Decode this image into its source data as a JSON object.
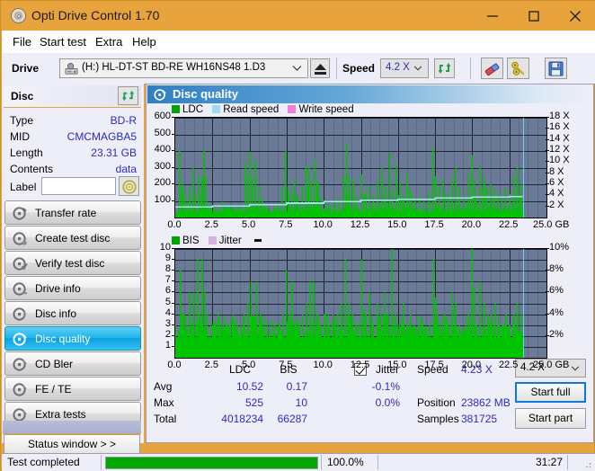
{
  "window": {
    "title": "Opti Drive Control 1.70",
    "icon": "disc-icon",
    "controls": {
      "minimize": "minimize-icon",
      "maximize": "maximize-icon",
      "close": "close-icon"
    },
    "accent_color": "#e8a33d"
  },
  "menu": {
    "items": [
      "File",
      "Start test",
      "Extra",
      "Help"
    ]
  },
  "toolbar": {
    "drive_label": "Drive",
    "drive_value": "(H:)   HL-DT-ST BD-RE  WH16NS48 1.D3",
    "eject_button": "eject-icon",
    "speed_label": "Speed",
    "speed_value": "4.2 X",
    "refresh_button": "refresh-icon",
    "erase_button": "eraser-icon",
    "tools_button": "tools-icon",
    "save_button": "save-icon"
  },
  "disc": {
    "header": "Disc",
    "refresh_icon": "refresh-icon",
    "rows": [
      {
        "label": "Type",
        "value": "BD-R"
      },
      {
        "label": "MID",
        "value": "CMCMAGBA5"
      },
      {
        "label": "Length",
        "value": "23.31 GB"
      },
      {
        "label": "Contents",
        "value": "data"
      }
    ],
    "label_field_label": "Label",
    "label_field_value": "",
    "label_field_placeholder": "",
    "disc_icon": "cd-icon"
  },
  "nav": {
    "items": [
      {
        "label": "Transfer rate",
        "icon": "disc-test-icon",
        "active": false
      },
      {
        "label": "Create test disc",
        "icon": "disc-burn-icon",
        "active": false
      },
      {
        "label": "Verify test disc",
        "icon": "disc-verify-icon",
        "active": false
      },
      {
        "label": "Drive info",
        "icon": "drive-info-icon",
        "active": false
      },
      {
        "label": "Disc info",
        "icon": "disc-info-icon",
        "active": false
      },
      {
        "label": "Disc quality",
        "icon": "disc-quality-icon",
        "active": true
      },
      {
        "label": "CD Bler",
        "icon": "cd-bler-icon",
        "active": false
      },
      {
        "label": "FE / TE",
        "icon": "fe-te-icon",
        "active": false
      },
      {
        "label": "Extra tests",
        "icon": "extra-tests-icon",
        "active": false
      }
    ],
    "status_window_button": "Status window > >"
  },
  "panel": {
    "title": "Disc quality",
    "icon": "disc-quality-icon"
  },
  "chart_data": [
    {
      "type": "line",
      "name": "ldc-chart",
      "title": "",
      "legend": [
        {
          "label": "LDC",
          "color": "#00a400"
        },
        {
          "label": "Read speed",
          "color": "#9fd9f2"
        },
        {
          "label": "Write speed",
          "color": "#f57ae0"
        }
      ],
      "legend_position": "top-left",
      "grid": true,
      "xlabel": "",
      "xunit": "GB",
      "x": [
        0.0,
        2.5,
        5.0,
        7.5,
        10.0,
        12.5,
        15.0,
        17.5,
        20.0,
        22.5,
        25.0
      ],
      "xlim": [
        0.0,
        25.0
      ],
      "xtick_labels": [
        "0.0",
        "2.5",
        "5.0",
        "7.5",
        "10.0",
        "12.5",
        "15.0",
        "17.5",
        "20.0",
        "22.5",
        "25.0 GB"
      ],
      "ylabel": "",
      "ylim": [
        0,
        600
      ],
      "ytick_labels": [
        "100",
        "200",
        "300",
        "400",
        "500",
        "600"
      ],
      "y2label": "",
      "y2lim": [
        0,
        18
      ],
      "y2tick_labels": [
        "2 X",
        "4 X",
        "6 X",
        "8 X",
        "10 X",
        "12 X",
        "14 X",
        "16 X",
        "18 X"
      ],
      "series": [
        {
          "name": "LDC",
          "color": "#00c400",
          "type": "spike",
          "data_end_x": 23.4,
          "baseline": 30,
          "peaks": [
            [
              0.25,
              400
            ],
            [
              0.45,
              210
            ],
            [
              0.6,
              150
            ],
            [
              0.75,
              95
            ],
            [
              0.95,
              180
            ],
            [
              1.15,
              300
            ],
            [
              1.3,
              105
            ],
            [
              1.55,
              245
            ],
            [
              1.75,
              245
            ],
            [
              1.9,
              410
            ],
            [
              2.05,
              120
            ],
            [
              2.35,
              80
            ],
            [
              2.6,
              70
            ],
            [
              2.9,
              60
            ],
            [
              3.15,
              95
            ],
            [
              3.4,
              65
            ],
            [
              3.65,
              85
            ],
            [
              3.9,
              60
            ],
            [
              4.2,
              80
            ],
            [
              4.45,
              60
            ],
            [
              4.7,
              330
            ],
            [
              4.85,
              260
            ],
            [
              5.0,
              395
            ],
            [
              5.15,
              235
            ],
            [
              5.35,
              350
            ],
            [
              5.6,
              190
            ],
            [
              5.8,
              120
            ],
            [
              6.0,
              80
            ],
            [
              6.3,
              60
            ],
            [
              6.6,
              75
            ],
            [
              6.9,
              85
            ],
            [
              7.15,
              180
            ],
            [
              7.4,
              400
            ],
            [
              7.6,
              140
            ],
            [
              7.8,
              160
            ],
            [
              8.0,
              230
            ],
            [
              8.2,
              120
            ],
            [
              8.5,
              190
            ],
            [
              8.75,
              310
            ],
            [
              8.95,
              300
            ],
            [
              9.1,
              215
            ],
            [
              9.35,
              350
            ],
            [
              9.55,
              215
            ],
            [
              9.8,
              110
            ],
            [
              10.1,
              95
            ],
            [
              10.4,
              80
            ],
            [
              10.7,
              100
            ],
            [
              11.0,
              120
            ],
            [
              11.3,
              250
            ],
            [
              11.5,
              440
            ],
            [
              11.7,
              160
            ],
            [
              11.95,
              230
            ],
            [
              12.2,
              120
            ],
            [
              12.5,
              260
            ],
            [
              12.8,
              150
            ],
            [
              13.0,
              190
            ],
            [
              13.3,
              130
            ],
            [
              13.6,
              230
            ],
            [
              13.9,
              300
            ],
            [
              14.1,
              190
            ],
            [
              14.4,
              390
            ],
            [
              14.6,
              160
            ],
            [
              14.85,
              320
            ],
            [
              15.1,
              210
            ],
            [
              15.35,
              130
            ],
            [
              15.6,
              260
            ],
            [
              15.85,
              150
            ],
            [
              16.1,
              110
            ],
            [
              16.4,
              130
            ],
            [
              16.7,
              100
            ],
            [
              17.0,
              160
            ],
            [
              17.3,
              420
            ],
            [
              17.5,
              250
            ],
            [
              17.75,
              190
            ],
            [
              18.0,
              230
            ],
            [
              18.3,
              150
            ],
            [
              18.6,
              240
            ],
            [
              18.85,
              300
            ],
            [
              19.1,
              180
            ],
            [
              19.4,
              130
            ],
            [
              19.7,
              260
            ],
            [
              19.95,
              375
            ],
            [
              20.2,
              150
            ],
            [
              20.5,
              310
            ],
            [
              20.75,
              240
            ],
            [
              20.95,
              180
            ],
            [
              21.2,
              200
            ],
            [
              21.45,
              170
            ],
            [
              21.7,
              150
            ],
            [
              21.95,
              130
            ],
            [
              22.2,
              180
            ],
            [
              22.5,
              140
            ],
            [
              22.75,
              250
            ],
            [
              23.0,
              300
            ],
            [
              23.25,
              200
            ]
          ]
        },
        {
          "name": "Read speed",
          "color": "#a9e2f7",
          "type": "step",
          "points": [
            [
              0.0,
              1.9
            ],
            [
              2.5,
              2.1
            ],
            [
              5.0,
              2.3
            ],
            [
              7.5,
              2.6
            ],
            [
              10.0,
              2.9
            ],
            [
              12.5,
              3.1
            ],
            [
              15.0,
              3.3
            ],
            [
              17.5,
              3.5
            ],
            [
              20.0,
              3.7
            ],
            [
              22.5,
              3.8
            ],
            [
              23.4,
              3.8
            ]
          ]
        },
        {
          "name": "Write speed",
          "color": "#f57ae0",
          "type": "none",
          "points": []
        }
      ],
      "cursor_x": 23.4,
      "cursor_color": "#5fd5f0"
    },
    {
      "type": "line",
      "name": "bis-chart",
      "title": "",
      "legend": [
        {
          "label": "BIS",
          "color": "#00a400"
        },
        {
          "label": "Jitter",
          "color": "#d9aee0"
        }
      ],
      "legend_position": "top-left",
      "grid": true,
      "xlabel": "",
      "xunit": "GB",
      "x": [
        0.0,
        2.5,
        5.0,
        7.5,
        10.0,
        12.5,
        15.0,
        17.5,
        20.0,
        22.5,
        25.0
      ],
      "xlim": [
        0.0,
        25.0
      ],
      "xtick_labels": [
        "0.0",
        "2.5",
        "5.0",
        "7.5",
        "10.0",
        "12.5",
        "15.0",
        "17.5",
        "20.0",
        "22.5",
        "25.0 GB"
      ],
      "ylabel": "",
      "ylim": [
        0,
        10
      ],
      "ytick_labels": [
        "1",
        "2",
        "3",
        "4",
        "5",
        "6",
        "7",
        "8",
        "9",
        "10"
      ],
      "y2label": "",
      "y2lim": [
        0,
        10
      ],
      "y2tick_labels": [
        "2%",
        "4%",
        "6%",
        "8%",
        "10%"
      ],
      "series": [
        {
          "name": "BIS",
          "color": "#00c400",
          "type": "spike",
          "data_end_x": 23.4,
          "baseline": 1.9,
          "peaks": [
            [
              0.3,
              8
            ],
            [
              0.55,
              4
            ],
            [
              0.75,
              3
            ],
            [
              0.95,
              6
            ],
            [
              1.2,
              6
            ],
            [
              1.45,
              9
            ],
            [
              1.6,
              4
            ],
            [
              1.8,
              9
            ],
            [
              2.1,
              4
            ],
            [
              2.35,
              1.2
            ],
            [
              2.6,
              3
            ],
            [
              2.85,
              4
            ],
            [
              3.1,
              3
            ],
            [
              3.35,
              3
            ],
            [
              3.6,
              3
            ],
            [
              3.85,
              2.6
            ],
            [
              4.1,
              2.5
            ],
            [
              4.35,
              3
            ],
            [
              4.6,
              4
            ],
            [
              4.85,
              5
            ],
            [
              5.05,
              7
            ],
            [
              5.25,
              4
            ],
            [
              5.45,
              7
            ],
            [
              5.7,
              4
            ],
            [
              5.95,
              3
            ],
            [
              6.2,
              1.4
            ],
            [
              6.45,
              1.2
            ],
            [
              6.7,
              1.4
            ],
            [
              6.95,
              2.8
            ],
            [
              7.2,
              4
            ],
            [
              7.45,
              8
            ],
            [
              7.65,
              4
            ],
            [
              7.85,
              7
            ],
            [
              8.05,
              3
            ],
            [
              8.3,
              3
            ],
            [
              8.55,
              4
            ],
            [
              8.8,
              5
            ],
            [
              9.05,
              7
            ],
            [
              9.25,
              7
            ],
            [
              9.5,
              4
            ],
            [
              9.75,
              3
            ],
            [
              10.0,
              4
            ],
            [
              10.3,
              3
            ],
            [
              10.6,
              3
            ],
            [
              10.9,
              4
            ],
            [
              11.15,
              5
            ],
            [
              11.4,
              9
            ],
            [
              11.65,
              5
            ],
            [
              11.9,
              4
            ],
            [
              12.2,
              3
            ],
            [
              12.5,
              9
            ],
            [
              12.8,
              4
            ],
            [
              13.05,
              6
            ],
            [
              13.3,
              3
            ],
            [
              13.55,
              5
            ],
            [
              13.8,
              4
            ],
            [
              14.05,
              6
            ],
            [
              14.3,
              4
            ],
            [
              14.55,
              10
            ],
            [
              14.8,
              4
            ],
            [
              15.05,
              3
            ],
            [
              15.3,
              5
            ],
            [
              15.55,
              3
            ],
            [
              15.8,
              4
            ],
            [
              16.05,
              3
            ],
            [
              16.35,
              2.5
            ],
            [
              16.6,
              3
            ],
            [
              16.85,
              2.5
            ],
            [
              17.1,
              3
            ],
            [
              17.35,
              9
            ],
            [
              17.6,
              4
            ],
            [
              17.85,
              3
            ],
            [
              18.1,
              4
            ],
            [
              18.35,
              3
            ],
            [
              18.6,
              6
            ],
            [
              18.85,
              5
            ],
            [
              19.1,
              3
            ],
            [
              19.4,
              2.5
            ],
            [
              19.7,
              4
            ],
            [
              19.95,
              10
            ],
            [
              20.2,
              3
            ],
            [
              20.5,
              7
            ],
            [
              20.75,
              5
            ],
            [
              21.0,
              4
            ],
            [
              21.25,
              4
            ],
            [
              21.5,
              5
            ],
            [
              21.75,
              3
            ],
            [
              22.0,
              3
            ],
            [
              22.25,
              4
            ],
            [
              22.5,
              3
            ],
            [
              22.75,
              4
            ],
            [
              23.0,
              5
            ],
            [
              23.25,
              4
            ]
          ]
        },
        {
          "name": "Jitter",
          "color": "#d9aee0",
          "type": "none",
          "points": []
        }
      ],
      "cursor_x": 23.4,
      "cursor_color": "#5fd5f0"
    }
  ],
  "stats": {
    "col_headers": [
      "LDC",
      "BIS"
    ],
    "row_labels": [
      "Avg",
      "Max",
      "Total"
    ],
    "ldc": {
      "avg": "10.52",
      "max": "525",
      "total": "4018234"
    },
    "bis": {
      "avg": "0.17",
      "max": "10",
      "total": "66287"
    },
    "jitter": {
      "label": "Jitter",
      "checked": true,
      "avg": "-0.1%",
      "max": "0.0%"
    },
    "right": {
      "speed_label": "Speed",
      "speed_value": "4.23 X",
      "position_label": "Position",
      "position_value": "23862 MB",
      "samples_label": "Samples",
      "samples_value": "381725"
    },
    "speed_select": "4.2 X",
    "start_full_button": "Start full",
    "start_part_button": "Start part"
  },
  "statusbar": {
    "message": "Test completed",
    "progress_percent": "100.0%",
    "progress_value": 100,
    "elapsed": "31:27",
    "progress_color": "#00a800"
  }
}
